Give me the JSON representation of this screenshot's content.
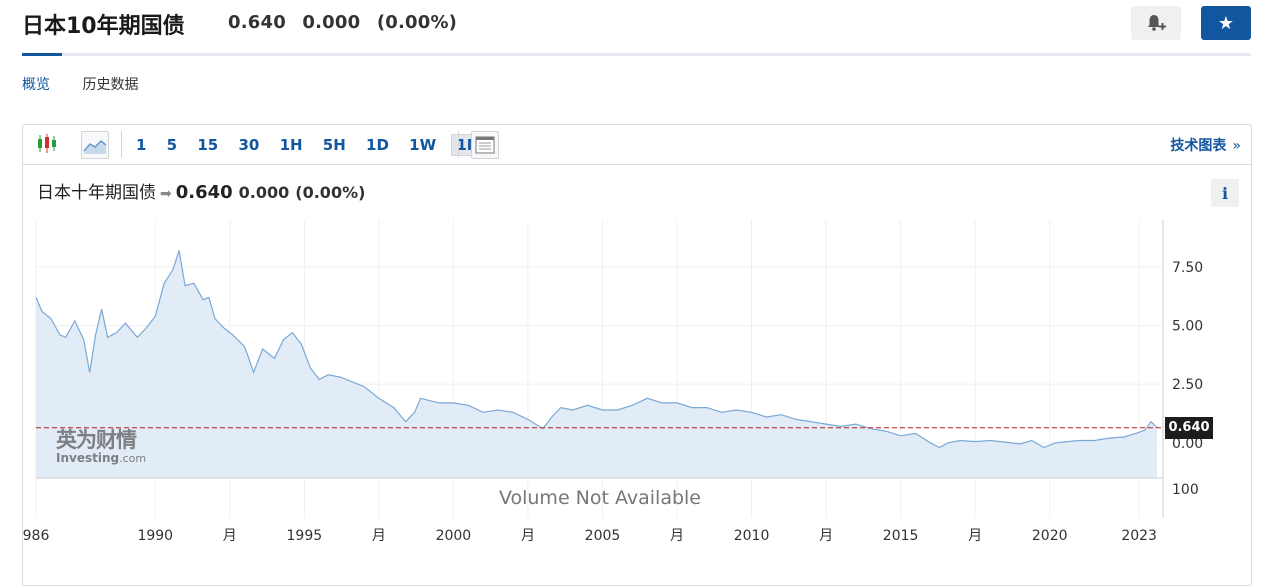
{
  "header": {
    "title": "日本10年期国债",
    "last": "0.640",
    "change": "0.000",
    "change_pct": "(0.00%)"
  },
  "subnav": {
    "items": [
      "概览",
      "历史数据"
    ],
    "active": 0
  },
  "toolbar": {
    "intervals": [
      "1",
      "5",
      "15",
      "30",
      "1H",
      "5H",
      "1D",
      "1W",
      "1M"
    ],
    "active_interval": "1M",
    "tech_link": "技术图表",
    "tech_arrow": "»"
  },
  "chart_header": {
    "name": "日本十年期国债",
    "price": "0.640",
    "change": "0.000",
    "change_pct": "(0.00%)",
    "info": "i"
  },
  "watermark": {
    "cn": "英为财情",
    "en": "Investing",
    "en_suffix": ".com"
  },
  "volume_note": "Volume Not Available",
  "volume_tick": "100",
  "price_label": "0.640",
  "colors": {
    "brand": "#1256a0",
    "line": "#7aa9d6",
    "fill": "#e2ecf6",
    "ref_line": "#b22222"
  },
  "icons": {
    "bell": "bell-plus-icon",
    "star": "star-icon",
    "candles": "candlestick-icon",
    "area": "area-chart-icon",
    "table": "table-icon"
  },
  "chart_data": {
    "type": "area",
    "title": "日本十年期国债",
    "ylim": [
      -1.5,
      9.5
    ],
    "xlim": [
      1986.0,
      2023.8
    ],
    "yticks": [
      {
        "v": 7.5,
        "label": "7.50"
      },
      {
        "v": 5.0,
        "label": "5.00"
      },
      {
        "v": 2.5,
        "label": "2.50"
      },
      {
        "v": 0.0,
        "label": "0.00"
      }
    ],
    "xticks": [
      {
        "v": 1986.0,
        "label": "986"
      },
      {
        "v": 1990.0,
        "label": "1990"
      },
      {
        "v": 1992.5,
        "label": "月"
      },
      {
        "v": 1995.0,
        "label": "1995"
      },
      {
        "v": 1997.5,
        "label": "月"
      },
      {
        "v": 2000.0,
        "label": "2000"
      },
      {
        "v": 2002.5,
        "label": "月"
      },
      {
        "v": 2005.0,
        "label": "2005"
      },
      {
        "v": 2007.5,
        "label": "月"
      },
      {
        "v": 2010.0,
        "label": "2010"
      },
      {
        "v": 2012.5,
        "label": "月"
      },
      {
        "v": 2015.0,
        "label": "2015"
      },
      {
        "v": 2017.5,
        "label": "月"
      },
      {
        "v": 2020.0,
        "label": "2020"
      },
      {
        "v": 2023.0,
        "label": "2023"
      }
    ],
    "ref_line": 0.64,
    "x": [
      1986.0,
      1986.2,
      1986.5,
      1986.8,
      1987.0,
      1987.3,
      1987.6,
      1987.8,
      1988.0,
      1988.2,
      1988.4,
      1988.7,
      1989.0,
      1989.4,
      1989.7,
      1990.0,
      1990.3,
      1990.6,
      1990.8,
      1991.0,
      1991.3,
      1991.6,
      1991.8,
      1992.0,
      1992.3,
      1992.6,
      1993.0,
      1993.3,
      1993.6,
      1994.0,
      1994.3,
      1994.6,
      1994.9,
      1995.2,
      1995.5,
      1995.8,
      1996.2,
      1996.6,
      1997.0,
      1997.5,
      1998.0,
      1998.4,
      1998.7,
      1998.9,
      1999.2,
      1999.5,
      2000.0,
      2000.5,
      2001.0,
      2001.5,
      2002.0,
      2002.5,
      2003.0,
      2003.3,
      2003.6,
      2004.0,
      2004.5,
      2005.0,
      2005.5,
      2006.0,
      2006.5,
      2007.0,
      2007.5,
      2008.0,
      2008.5,
      2009.0,
      2009.5,
      2010.0,
      2010.5,
      2011.0,
      2011.5,
      2012.0,
      2012.5,
      2013.0,
      2013.5,
      2014.0,
      2014.5,
      2015.0,
      2015.5,
      2016.0,
      2016.3,
      2016.6,
      2017.0,
      2017.5,
      2018.0,
      2018.5,
      2019.0,
      2019.4,
      2019.8,
      2020.2,
      2020.6,
      2021.0,
      2021.5,
      2022.0,
      2022.5,
      2023.0,
      2023.2,
      2023.4,
      2023.6
    ],
    "y": [
      6.2,
      5.6,
      5.3,
      4.6,
      4.5,
      5.2,
      4.4,
      3.0,
      4.6,
      5.7,
      4.5,
      4.7,
      5.1,
      4.5,
      4.9,
      5.4,
      6.8,
      7.4,
      8.2,
      6.7,
      6.8,
      6.1,
      6.2,
      5.3,
      4.9,
      4.6,
      4.1,
      3.0,
      4.0,
      3.6,
      4.4,
      4.7,
      4.2,
      3.2,
      2.7,
      2.9,
      2.8,
      2.6,
      2.4,
      1.9,
      1.5,
      0.9,
      1.3,
      1.9,
      1.8,
      1.7,
      1.7,
      1.6,
      1.3,
      1.4,
      1.3,
      1.0,
      0.6,
      1.1,
      1.5,
      1.4,
      1.6,
      1.4,
      1.4,
      1.6,
      1.9,
      1.7,
      1.7,
      1.5,
      1.5,
      1.3,
      1.4,
      1.3,
      1.1,
      1.2,
      1.0,
      0.9,
      0.8,
      0.7,
      0.8,
      0.6,
      0.5,
      0.3,
      0.4,
      0.0,
      -0.2,
      0.0,
      0.1,
      0.05,
      0.1,
      0.03,
      -0.05,
      0.1,
      -0.2,
      0.0,
      0.05,
      0.1,
      0.1,
      0.2,
      0.25,
      0.45,
      0.55,
      0.9,
      0.64
    ]
  }
}
